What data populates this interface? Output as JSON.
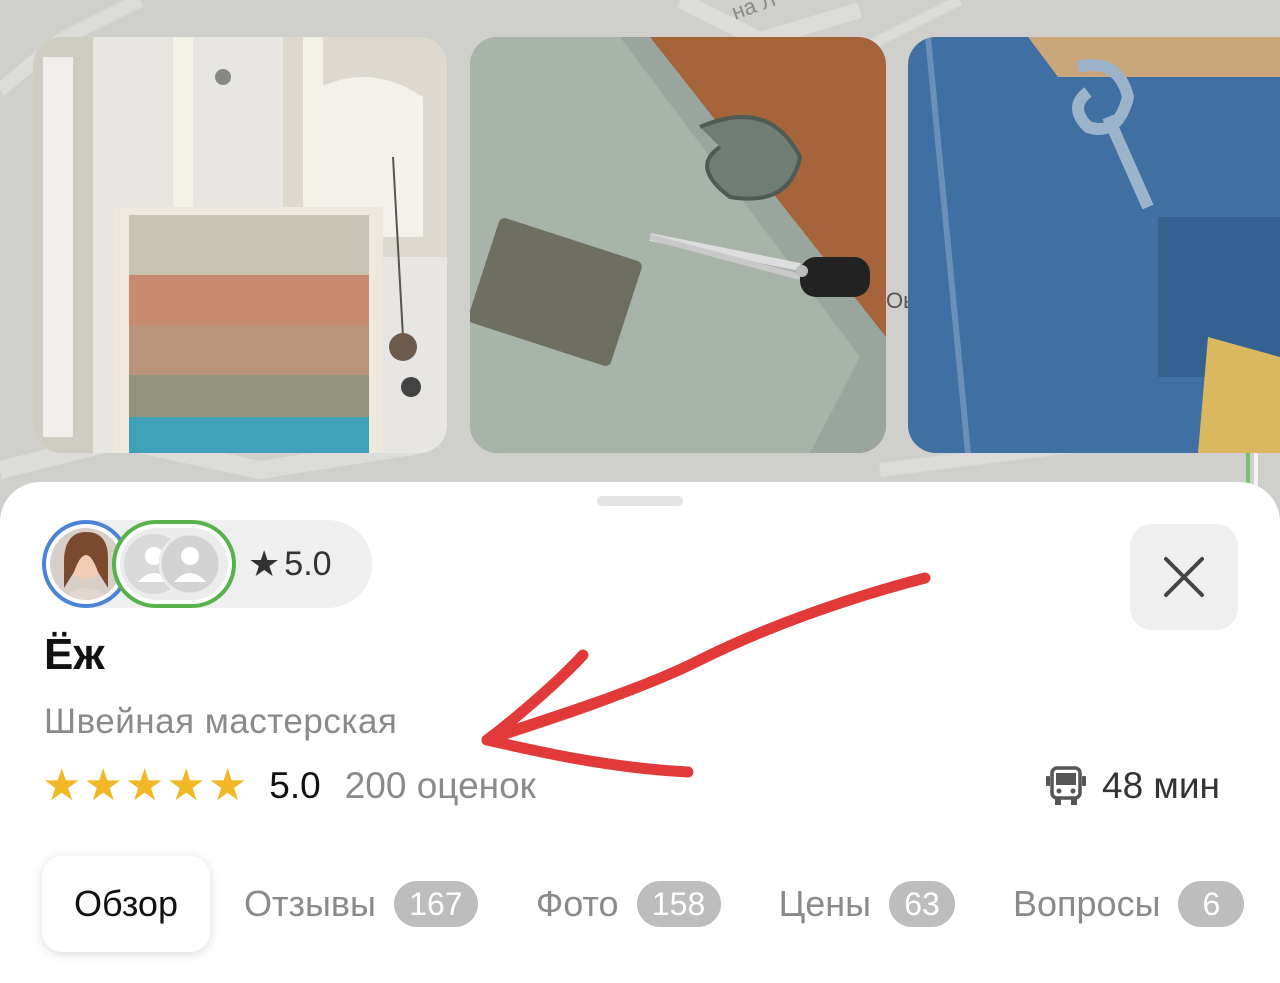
{
  "map": {
    "street_label": "на Л",
    "edge_label": "Оь"
  },
  "place": {
    "rating_badge": "5.0",
    "name": "Ёж",
    "category": "Швейная мастерская",
    "rating_value": "5.0",
    "rating_count": "200 оценок",
    "stars": 5,
    "transit_time": "48 мин"
  },
  "tabs": [
    {
      "label": "Обзор",
      "count": null,
      "active": true
    },
    {
      "label": "Отзывы",
      "count": "167"
    },
    {
      "label": "Фото",
      "count": "158"
    },
    {
      "label": "Цены",
      "count": "63"
    },
    {
      "label": "Вопросы",
      "count": "6"
    }
  ],
  "colors": {
    "star": "#f1b726",
    "avatar_ring_1": "#4a84d6",
    "avatar_ring_2": "#55b449",
    "annotation_arrow": "#e23a3a"
  },
  "icons": {
    "close": "close-icon",
    "bus": "bus-icon",
    "star": "star-icon"
  }
}
